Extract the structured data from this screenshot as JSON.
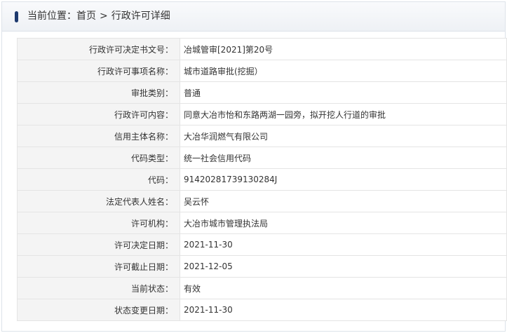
{
  "header": {
    "location_label": "当前位置：",
    "home": "首页",
    "separator": ">",
    "current": "行政许可详细"
  },
  "rows": [
    {
      "label": "行政许可决定书文号：",
      "value": "冶城管审[2021]第20号"
    },
    {
      "label": "行政许可事项名称：",
      "value": "城市道路审批(挖掘）"
    },
    {
      "label": "审批类别：",
      "value": "普通"
    },
    {
      "label": "行政许可内容：",
      "value": "同意大冶市怡和东路两湖一园旁，拟开挖人行道的审批"
    },
    {
      "label": "信用主体名称：",
      "value": "大冶华润燃气有限公司"
    },
    {
      "label": "代码类型：",
      "value": "统一社会信用代码"
    },
    {
      "label": "代码：",
      "value": "91420281739130284J"
    },
    {
      "label": "法定代表人姓名：",
      "value": "吴云怀"
    },
    {
      "label": "许可机构：",
      "value": "大冶市城市管理执法局"
    },
    {
      "label": "许可决定日期：",
      "value": "2021-11-30"
    },
    {
      "label": "许可截止日期：",
      "value": "2021-12-05"
    },
    {
      "label": "当前状态：",
      "value": "有效"
    },
    {
      "label": "状态变更日期：",
      "value": "2021-11-30"
    }
  ],
  "colors": {
    "accent_bar": "#1e3a6e",
    "label_bg": "#f4f4f4",
    "border": "#e4e4e4"
  }
}
